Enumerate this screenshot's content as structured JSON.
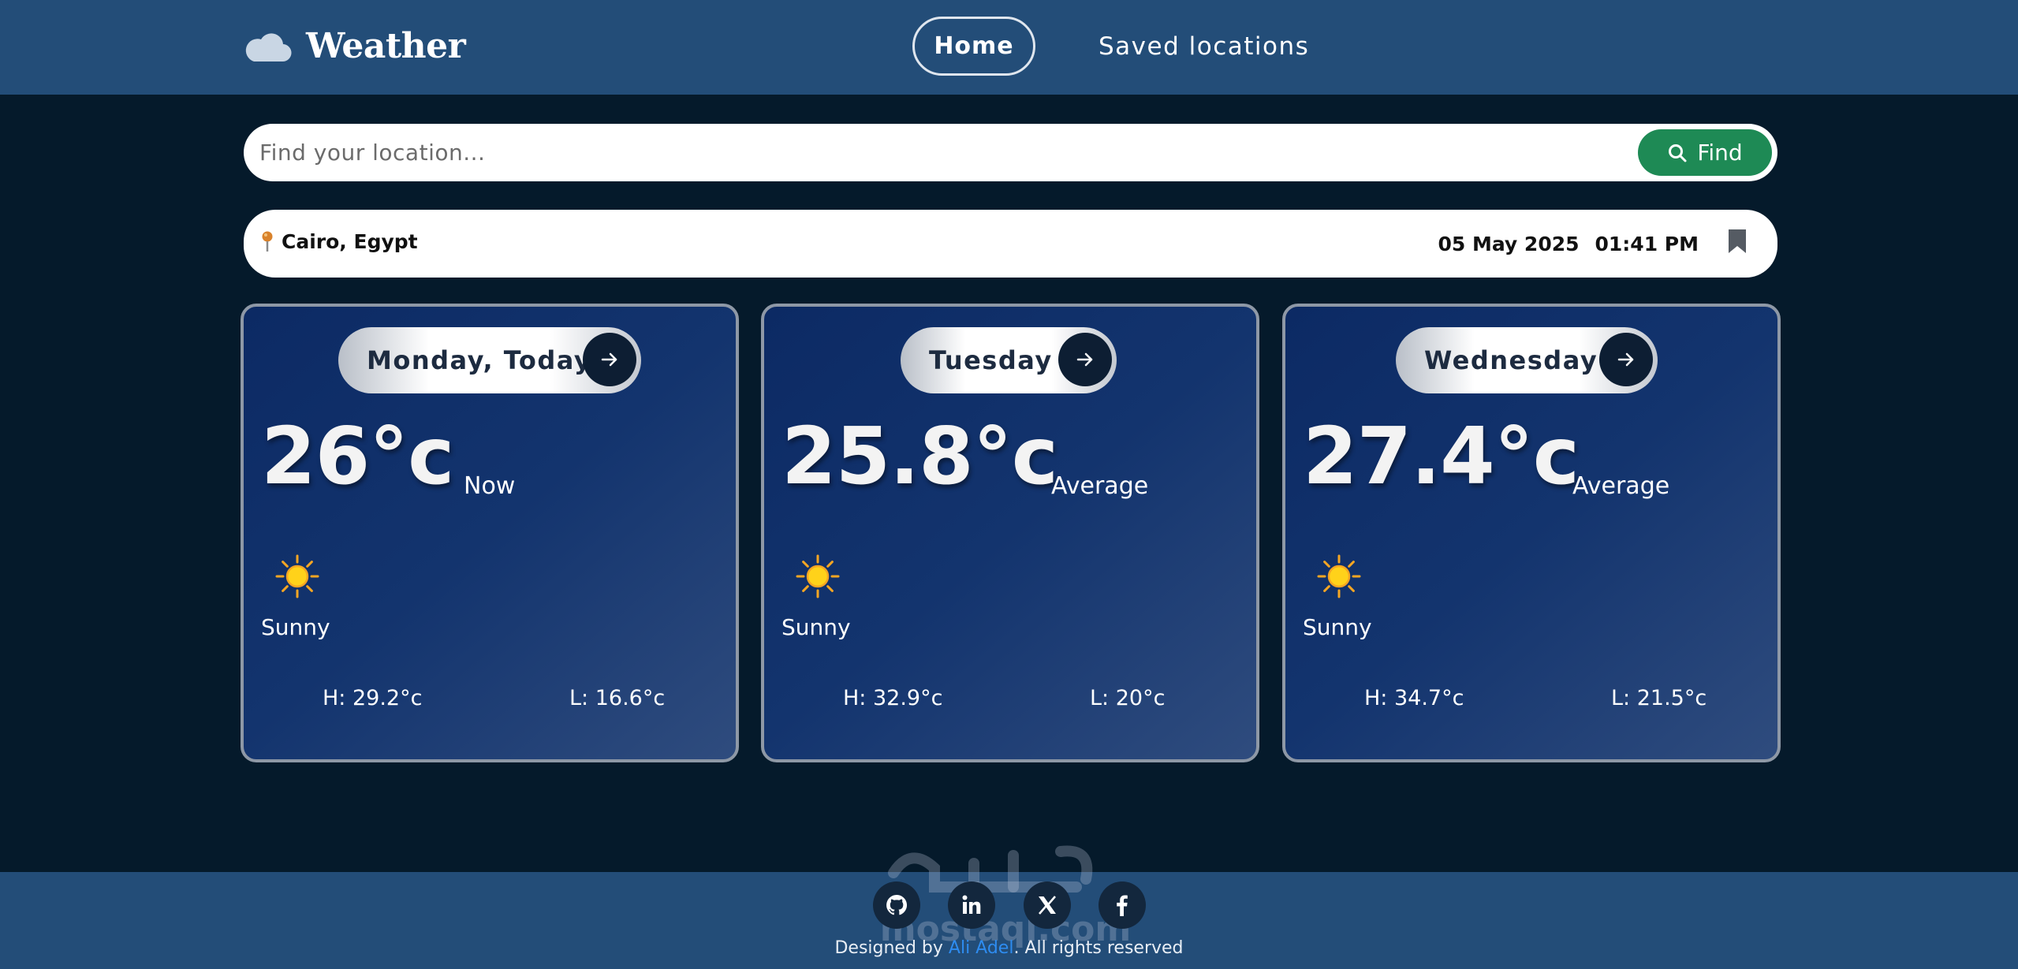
{
  "header": {
    "brand_name": "Weather",
    "brand_icon": "cloud-icon",
    "nav": {
      "home_label": "Home",
      "saved_label": "Saved locations"
    }
  },
  "search": {
    "placeholder": "Find your location...",
    "value": "",
    "button_label": "Find",
    "button_icon": "search-icon"
  },
  "location": {
    "name": "Cairo, Egypt",
    "date": "05 May 2025",
    "time": "01:41 PM",
    "pin_icon": "pin-icon",
    "bookmark_icon": "bookmark-icon"
  },
  "forecast": [
    {
      "day": "Monday, Today",
      "temp": "26°c",
      "temp_label": "Now",
      "condition": "Sunny",
      "icon": "sun-icon",
      "high": "H: 29.2°c",
      "low": "L: 16.6°c"
    },
    {
      "day": "Tuesday",
      "temp": "25.8°c",
      "temp_label": "Average",
      "condition": "Sunny",
      "icon": "sun-icon",
      "high": "H: 32.9°c",
      "low": "L: 20°c"
    },
    {
      "day": "Wednesday",
      "temp": "27.4°c",
      "temp_label": "Average",
      "condition": "Sunny",
      "icon": "sun-icon",
      "high": "H: 34.7°c",
      "low": "L: 21.5°c"
    }
  ],
  "footer": {
    "social_icons": [
      "github-icon",
      "linkedin-icon",
      "x-icon",
      "facebook-icon"
    ],
    "credits_prefix": "Designed by ",
    "credits_author": "Ali Adel",
    "credits_suffix": ". All rights reserved",
    "watermark_text": "mostaql.com"
  },
  "colors": {
    "page_bg": "#051a2b",
    "header_bg": "#234d78",
    "find_button": "#1e8a55",
    "card_border": "#8e98a6",
    "link": "#2e8cf0"
  }
}
